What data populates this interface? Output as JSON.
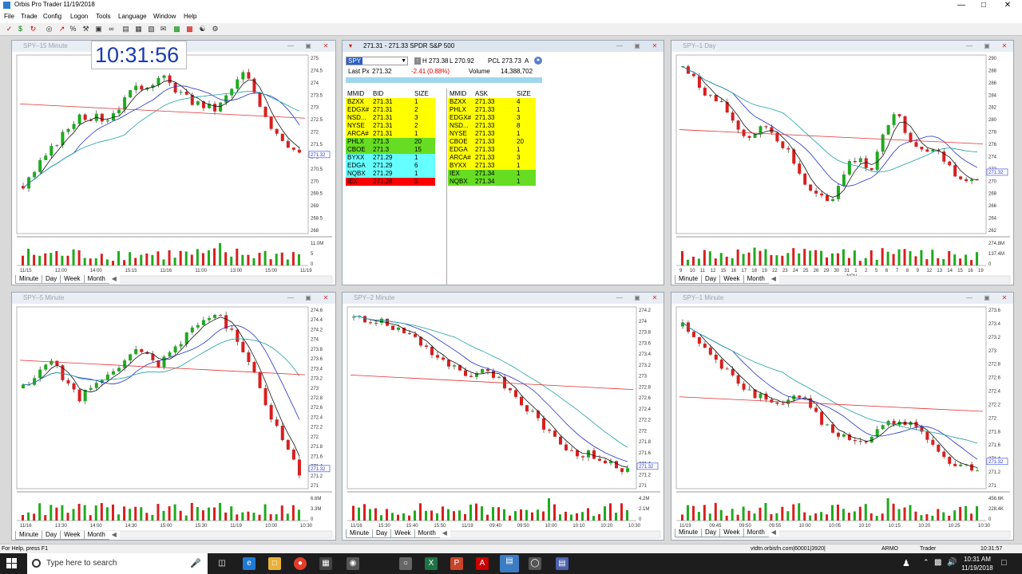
{
  "app": {
    "title": "Orbis Pro Trader  11/19/2018"
  },
  "menu": [
    "File",
    "Trade",
    "Config",
    "Logon",
    "Tools",
    "Language",
    "Window",
    "Help"
  ],
  "clock": "10:31:56",
  "quote": {
    "title": "271.31 - 271.33   SPDR S&#38;P 500",
    "symbol": "SPY",
    "high_label": "H 273.38",
    "low_label": "L 270.92",
    "pcl": "PCL 273.73",
    "last_label": "Last Px",
    "last": "271.32",
    "change": "-2.41",
    "change_pct": "(0.88%)",
    "volume_label": "Volume",
    "volume": "14,388,702",
    "type_flag": "A"
  },
  "book_headers": {
    "bid": [
      "MMID",
      "BID",
      "SIZE"
    ],
    "ask": [
      "MMID",
      "ASK",
      "SIZE"
    ]
  },
  "bid_rows": [
    {
      "mmid": "BZXX",
      "px": "271.31",
      "size": "1",
      "color": "#ffff00"
    },
    {
      "mmid": "EDGX#",
      "px": "271.31",
      "size": "2",
      "color": "#ffff00"
    },
    {
      "mmid": "NSD...",
      "px": "271.31",
      "size": "3",
      "color": "#ffff00"
    },
    {
      "mmid": "NYSE",
      "px": "271.31",
      "size": "2",
      "color": "#ffff00"
    },
    {
      "mmid": "ARCA#",
      "px": "271.31",
      "size": "1",
      "color": "#ffff00"
    },
    {
      "mmid": "PHLX",
      "px": "271.3",
      "size": "20",
      "color": "#66dd22"
    },
    {
      "mmid": "CBOE",
      "px": "271.3",
      "size": "15",
      "color": "#66dd22"
    },
    {
      "mmid": "BYXX",
      "px": "271.29",
      "size": "1",
      "color": "#66ffff"
    },
    {
      "mmid": "EDGA",
      "px": "271.29",
      "size": "6",
      "color": "#66ffff"
    },
    {
      "mmid": "NQBX",
      "px": "271.29",
      "size": "1",
      "color": "#66ffff"
    },
    {
      "mmid": "IEX",
      "px": "271.28",
      "size": "5",
      "color": "#ff0000"
    }
  ],
  "ask_rows": [
    {
      "mmid": "BZXX",
      "px": "271.33",
      "size": "4",
      "color": "#ffff00"
    },
    {
      "mmid": "PHLX",
      "px": "271.33",
      "size": "1",
      "color": "#ffff00"
    },
    {
      "mmid": "EDGX#",
      "px": "271.33",
      "size": "3",
      "color": "#ffff00"
    },
    {
      "mmid": "NSD...",
      "px": "271.33",
      "size": "8",
      "color": "#ffff00"
    },
    {
      "mmid": "NYSE",
      "px": "271.33",
      "size": "1",
      "color": "#ffff00"
    },
    {
      "mmid": "CBOE",
      "px": "271.33",
      "size": "20",
      "color": "#ffff00"
    },
    {
      "mmid": "EDGA",
      "px": "271.33",
      "size": "1",
      "color": "#ffff00"
    },
    {
      "mmid": "ARCA#",
      "px": "271.33",
      "size": "3",
      "color": "#ffff00"
    },
    {
      "mmid": "BYXX",
      "px": "271.33",
      "size": "1",
      "color": "#ffff00"
    },
    {
      "mmid": "IEX",
      "px": "271.34",
      "size": "1",
      "color": "#66dd22"
    },
    {
      "mmid": "NQBX",
      "px": "271.34",
      "size": "1",
      "color": "#66dd22"
    }
  ],
  "tabs": [
    "Minute",
    "Day",
    "Week",
    "Month"
  ],
  "charts": [
    {
      "id": "c15",
      "title": "SPY--15 Minute",
      "yticks": [
        "275",
        "274.5",
        "274",
        "273.5",
        "273",
        "272.5",
        "272",
        "271.5",
        "271",
        "270.5",
        "270",
        "269.5",
        "269",
        "268.5",
        "268"
      ],
      "last_tag": "271.32",
      "vol_ticks": [
        "11.0M",
        "5",
        "0"
      ],
      "xticks": [
        "11/15",
        "12:00",
        "14:00",
        "15:15",
        "11/16",
        "11:00",
        "13:00",
        "15:00",
        "11/19"
      ],
      "price_range": [
        268,
        275.5
      ],
      "seed": 3,
      "trend": [
        270,
        271.5,
        273,
        272.8,
        274,
        274.6,
        273.6,
        273.2,
        274.8,
        272.5,
        271.3
      ]
    },
    {
      "id": "cday",
      "title": "SPY--1 Day",
      "yticks": [
        "290",
        "288",
        "286",
        "284",
        "282",
        "280",
        "278",
        "276",
        "274",
        "272",
        "270",
        "268",
        "266",
        "264",
        "262"
      ],
      "last_tag": "271.32",
      "vol_ticks": [
        "274.8M",
        "137.4M",
        "0"
      ],
      "xticks": [
        "9",
        "10",
        "11",
        "12",
        "15",
        "16",
        "17",
        "18",
        "19",
        "22",
        "23",
        "24",
        "25",
        "26",
        "29",
        "30",
        "31",
        "1",
        "2",
        "5",
        "6",
        "7",
        "8",
        "9",
        "12",
        "13",
        "14",
        "15",
        "16",
        "19"
      ],
      "xlabel": "NOV",
      "price_range": [
        261,
        291
      ],
      "seed": 7,
      "trend": [
        289,
        285,
        282,
        277,
        279,
        275,
        268,
        266,
        274,
        272,
        282,
        276,
        275,
        271,
        270
      ]
    },
    {
      "id": "c5",
      "title": "SPY--5 Minute",
      "yticks": [
        "274.6",
        "274.4",
        "274.2",
        "274",
        "273.8",
        "273.6",
        "273.4",
        "273.2",
        "273",
        "272.8",
        "272.6",
        "272.4",
        "272.2",
        "272",
        "271.8",
        "271.6",
        "271.4",
        "271.2",
        "271"
      ],
      "last_tag": "271.32",
      "vol_ticks": [
        "6.6M",
        "3.3M",
        "0"
      ],
      "xticks": [
        "11/16",
        "13:30",
        "14:00",
        "14:30",
        "15:00",
        "15:30",
        "11/19",
        "10:00",
        "10:30"
      ],
      "price_range": [
        270.9,
        274.7
      ],
      "seed": 11,
      "trend": [
        273,
        273.6,
        272.8,
        273.2,
        273.8,
        273.5,
        274.2,
        274.6,
        273.8,
        272.4,
        271.2
      ]
    },
    {
      "id": "c2",
      "title": "SPY--2 Minute",
      "yticks": [
        "274.2",
        "274",
        "273.8",
        "273.6",
        "273.4",
        "273.2",
        "273",
        "272.8",
        "272.6",
        "272.4",
        "272.2",
        "272",
        "271.8",
        "271.6",
        "271.4",
        "271.2",
        "271"
      ],
      "last_tag": "271.32",
      "vol_ticks": [
        "4.2M",
        "2.1M",
        "0"
      ],
      "xticks": [
        "11/16",
        "15:30",
        "15:40",
        "15:50",
        "11/19",
        "09:40",
        "09:50",
        "10:00",
        "10:10",
        "10:20",
        "10:30"
      ],
      "price_range": [
        270.9,
        274.3
      ],
      "seed": 19,
      "trend": [
        274.1,
        274.0,
        273.8,
        273.4,
        273.0,
        273.1,
        272.6,
        272.0,
        271.6,
        271.5,
        271.2
      ]
    },
    {
      "id": "c1",
      "title": "SPY--1 Minute",
      "yticks": [
        "273.6",
        "273.4",
        "273.2",
        "273",
        "272.8",
        "272.6",
        "272.4",
        "272.2",
        "272",
        "271.8",
        "271.6",
        "271.4",
        "271.2",
        "271"
      ],
      "last_tag": "271.32",
      "vol_ticks": [
        "456.6K",
        "228.4K",
        "0"
      ],
      "xticks": [
        "11/19",
        "09:45",
        "09:50",
        "09:55",
        "10:00",
        "10:05",
        "10:10",
        "10:15",
        "10:20",
        "10:25",
        "10:30"
      ],
      "price_range": [
        270.9,
        273.7
      ],
      "seed": 23,
      "trend": [
        273.4,
        272.9,
        272.5,
        272.2,
        272.3,
        271.8,
        271.6,
        271.9,
        271.9,
        271.3,
        271.2
      ]
    }
  ],
  "status": {
    "help": "For Help, press F1",
    "server": "vtdtn.orbisfn.com|60001|3920|",
    "user": "ARMO",
    "role": "Trader",
    "time": "10:31:57"
  },
  "taskbar": {
    "search_placeholder": "Type here to search",
    "time": "10:31 AM",
    "date": "11/19/2018"
  }
}
